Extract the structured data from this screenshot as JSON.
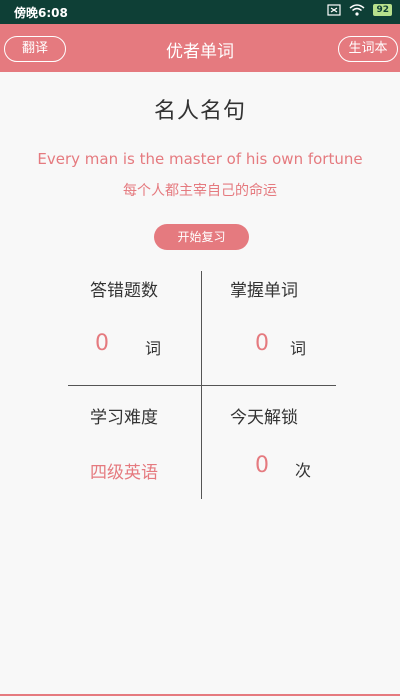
{
  "status_bar": {
    "time": "傍晚6:08",
    "battery": "92"
  },
  "app_bar": {
    "title": "优者单词",
    "left_button": "翻译",
    "right_button": "生词本"
  },
  "quote": {
    "heading": "名人名句",
    "english": "Every man is the master of his own  fortune",
    "chinese": "每个人都主宰自己的命运",
    "review_button": "开始复习"
  },
  "stats": {
    "wrong_answers": {
      "label": "答错题数",
      "value": "0",
      "unit": "词"
    },
    "mastered_words": {
      "label": "掌握单词",
      "value": "0",
      "unit": "词"
    },
    "difficulty": {
      "label": "学习难度",
      "value": "四级英语"
    },
    "unlocked_today": {
      "label": "今天解锁",
      "value": "0",
      "unit": "次"
    }
  },
  "colors": {
    "accent": "#e57a7f",
    "status_bar": "#0e3f36",
    "background": "#f8f8f8"
  }
}
